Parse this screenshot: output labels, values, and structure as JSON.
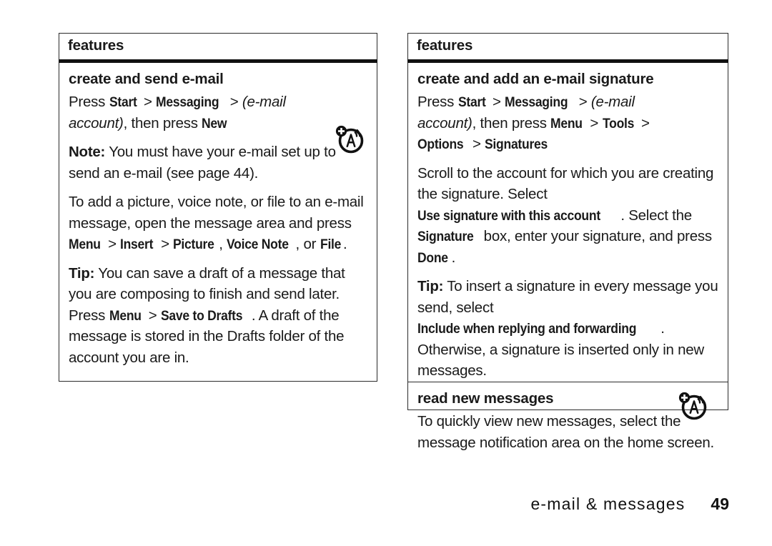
{
  "page": {
    "footer_label": "e-mail & messages",
    "page_number": "49",
    "icon_name": "messaging-alert-icon"
  },
  "left_panel": {
    "header": "features",
    "section_title": "create and send e-mail",
    "paragraphs": [
      {
        "id": "press-path",
        "runs": [
          {
            "text": "Press ",
            "style": "normal"
          },
          {
            "text": "Start",
            "style": "cmd"
          },
          {
            "text": " > ",
            "style": "normal"
          },
          {
            "text": "Messaging",
            "style": "cmd"
          },
          {
            "text": " > ",
            "style": "normal"
          },
          {
            "text": "(e-mail account)",
            "style": "italic"
          },
          {
            "text": ", then press ",
            "style": "normal"
          },
          {
            "text": "New",
            "style": "cmd"
          }
        ]
      },
      {
        "id": "note",
        "runs": [
          {
            "text": "Note:",
            "style": "lead"
          },
          {
            "text": " You must have your e-mail set up to send an e-mail (see page 44).",
            "style": "normal"
          }
        ]
      },
      {
        "id": "attach",
        "runs": [
          {
            "text": "To add a picture, voice note, or file to an e-mail message, open the message area and press ",
            "style": "normal"
          },
          {
            "text": "Menu",
            "style": "cmd"
          },
          {
            "text": " > ",
            "style": "normal"
          },
          {
            "text": "Insert",
            "style": "cmd"
          },
          {
            "text": " > ",
            "style": "normal"
          },
          {
            "text": "Picture",
            "style": "cmd"
          },
          {
            "text": ", ",
            "style": "normal"
          },
          {
            "text": "Voice Note",
            "style": "cmd"
          },
          {
            "text": ", or ",
            "style": "normal"
          },
          {
            "text": "File",
            "style": "cmd"
          },
          {
            "text": ".",
            "style": "normal"
          }
        ]
      },
      {
        "id": "tip-draft",
        "runs": [
          {
            "text": "Tip:",
            "style": "lead"
          },
          {
            "text": " You can save a draft of a message that you are composing to finish and send later. Press ",
            "style": "normal"
          },
          {
            "text": "Menu",
            "style": "cmd"
          },
          {
            "text": " > ",
            "style": "normal"
          },
          {
            "text": "Save to Drafts",
            "style": "cmd"
          },
          {
            "text": ". A draft of the message is stored in the Drafts folder of the account you are in.",
            "style": "normal"
          }
        ]
      }
    ]
  },
  "right_panel": {
    "header": "features",
    "section_title": "create and add an e-mail signature",
    "paragraphs": [
      {
        "id": "press-path",
        "runs": [
          {
            "text": "Press ",
            "style": "normal"
          },
          {
            "text": "Start",
            "style": "cmd"
          },
          {
            "text": " > ",
            "style": "normal"
          },
          {
            "text": "Messaging",
            "style": "cmd"
          },
          {
            "text": " > ",
            "style": "normal"
          },
          {
            "text": "(e-mail account)",
            "style": "italic"
          },
          {
            "text": ", then press ",
            "style": "normal"
          },
          {
            "text": "Menu",
            "style": "cmd"
          },
          {
            "text": " > ",
            "style": "normal"
          },
          {
            "text": "Tools",
            "style": "cmd"
          },
          {
            "text": " > ",
            "style": "normal"
          },
          {
            "text": "Options",
            "style": "cmd"
          },
          {
            "text": " > ",
            "style": "normal"
          },
          {
            "text": "Signatures",
            "style": "cmd"
          }
        ]
      },
      {
        "id": "scroll",
        "runs": [
          {
            "text": "Scroll to the account for which you are creating the signature. Select ",
            "style": "normal"
          },
          {
            "text": "Use signature with this account",
            "style": "cmd"
          },
          {
            "text": ". Select the ",
            "style": "normal"
          },
          {
            "text": "Signature",
            "style": "cmd"
          },
          {
            "text": " box, enter your signature, and press ",
            "style": "normal"
          },
          {
            "text": "Done",
            "style": "cmd"
          },
          {
            "text": ".",
            "style": "normal"
          }
        ]
      },
      {
        "id": "tip-signature",
        "runs": [
          {
            "text": "Tip:",
            "style": "lead"
          },
          {
            "text": " To insert a signature in every message you send, select ",
            "style": "normal"
          },
          {
            "text": "Include when replying and forwarding",
            "style": "cmd"
          },
          {
            "text": ". Otherwise, a signature is inserted only in new messages.",
            "style": "normal"
          }
        ]
      }
    ],
    "sub_section": {
      "title": "read new messages",
      "paragraphs": [
        {
          "id": "read-new",
          "runs": [
            {
              "text": "To quickly view new messages, select the message notification area on the home screen.",
              "style": "normal"
            }
          ]
        }
      ]
    }
  }
}
